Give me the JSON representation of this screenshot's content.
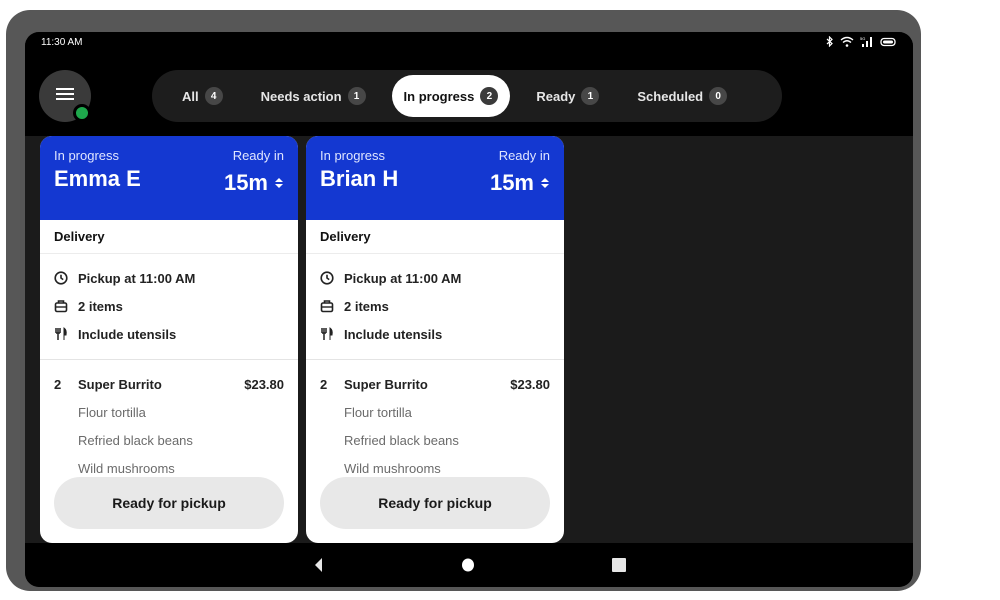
{
  "status_bar": {
    "time": "11:30 AM",
    "icons": [
      "bluetooth-icon",
      "wifi-icon",
      "signal-icon",
      "battery-icon"
    ]
  },
  "header": {
    "menu_icon": "hamburger-menu-icon",
    "online_status_color": "#1ea84c",
    "filters": [
      {
        "label": "All",
        "count": "4",
        "active": false
      },
      {
        "label": "Needs action",
        "count": "1",
        "active": false
      },
      {
        "label": "In progress",
        "count": "2",
        "active": true
      },
      {
        "label": "Ready",
        "count": "1",
        "active": false
      },
      {
        "label": "Scheduled",
        "count": "0",
        "active": false
      }
    ]
  },
  "colors": {
    "accent": "#1438d1",
    "background": "#1b1b1b",
    "online": "#1ea84c"
  },
  "orders": [
    {
      "status": "In progress",
      "customer": "Emma E",
      "ready_label": "Ready in",
      "eta": "15m",
      "type": "Delivery",
      "pickup": "Pickup at 11:00 AM",
      "item_count": "2 items",
      "utensils": "Include utensils",
      "items": [
        {
          "qty": "2",
          "name": "Super Burrito",
          "price": "$23.80",
          "modifiers": [
            "Flour tortilla",
            "Refried black beans",
            "Wild mushrooms"
          ]
        }
      ],
      "action": "Ready for pickup"
    },
    {
      "status": "In progress",
      "customer": "Brian H",
      "ready_label": "Ready in",
      "eta": "15m",
      "type": "Delivery",
      "pickup": "Pickup at 11:00 AM",
      "item_count": "2 items",
      "utensils": "Include utensils",
      "items": [
        {
          "qty": "2",
          "name": "Super Burrito",
          "price": "$23.80",
          "modifiers": [
            "Flour tortilla",
            "Refried black beans",
            "Wild mushrooms"
          ]
        }
      ],
      "action": "Ready for pickup"
    }
  ],
  "nav_bar": {
    "buttons": [
      "back-icon",
      "home-icon",
      "recents-icon"
    ]
  }
}
